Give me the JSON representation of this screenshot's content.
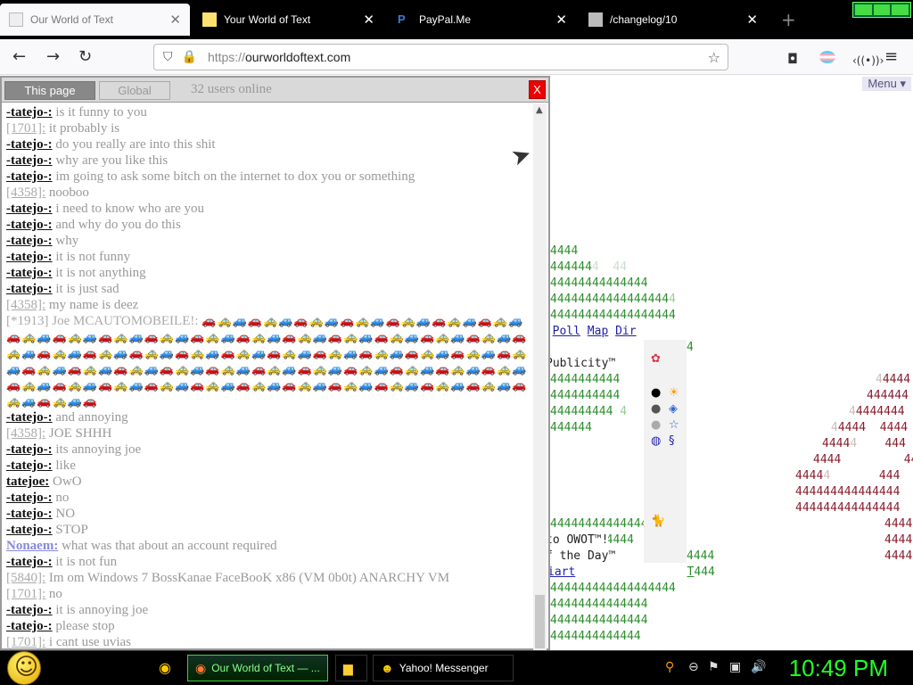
{
  "browser": {
    "tabs": [
      {
        "title": "Our World of Text",
        "active": true
      },
      {
        "title": "Your World of Text",
        "active": false
      },
      {
        "title": "PayPal.Me",
        "active": false
      },
      {
        "title": "/changelog/10",
        "active": false
      }
    ],
    "url_proto": "https://",
    "url_host": "ourworldoftext.com"
  },
  "owot": {
    "menu_label": "Menu ▾",
    "links": {
      "poll": "Poll",
      "map": "Map",
      "dir": "Dir",
      "wiki": "iart"
    },
    "texts": {
      "publicity": "Publicity™",
      "welcome": "to OWOT™!",
      "day": "f the Day™",
      "trail": "T"
    }
  },
  "chat": {
    "tab_page": "This page",
    "tab_global": "Global",
    "users_online": "32 users online",
    "close_label": "X",
    "messages": [
      {
        "nick": "-tatejo-:",
        "text": "is it funny to you"
      },
      {
        "nick": "[1701]:",
        "text": "it probably is"
      },
      {
        "nick": "-tatejo-:",
        "text": "do you really are into this shit"
      },
      {
        "nick": "-tatejo-:",
        "text": "why are you like this"
      },
      {
        "nick": "-tatejo-:",
        "text": "im going to ask some bitch on the internet to dox you or something"
      },
      {
        "nick": "[4358]:",
        "text": "nooboo"
      },
      {
        "nick": "-tatejo-:",
        "text": "i need to know who are you"
      },
      {
        "nick": "-tatejo-:",
        "text": "and why do you do this"
      },
      {
        "nick": "-tatejo-:",
        "text": "why"
      },
      {
        "nick": "-tatejo-:",
        "text": "it is not funny"
      },
      {
        "nick": "-tatejo-:",
        "text": "it is not anything"
      },
      {
        "nick": "-tatejo-:",
        "text": "it is just sad"
      },
      {
        "nick": "[4358]:",
        "text": "my name is deez"
      },
      {
        "nick": "[*1913] Joe MCAUTOMOBEILE!:",
        "text": "🚗🚕🚙🚗🚕🚙🚗🚕🚙🚗🚕🚙🚗🚕🚙🚗🚕🚙🚗🚕🚙🚗🚕🚙🚗🚕🚙🚗🚕🚙🚗🚕🚙🚗🚕🚙🚗🚕🚙🚗🚕🚙🚗🚕🚙🚗🚕🚙🚗🚕🚙🚗🚕🚙🚗🚕🚙🚗🚕🚙🚗🚕🚙🚗🚕🚙🚗🚕🚙🚗🚕🚙🚗🚕🚙🚗🚕🚙🚗🚕🚙🚗🚕🚙🚗🚕🚙🚗🚕🚙🚗🚕🚙🚗🚕🚙🚗🚕🚙🚗🚕🚙🚗🚕🚙🚗🚕🚙🚗🚕🚙🚗🚕🚙🚗🚕🚙🚗🚕🚙🚗🚕🚙🚗🚕🚙🚗🚕🚙🚗🚕🚙🚗🚕🚙🚗🚕🚙🚗🚕🚙🚗🚕🚙🚗🚕🚙🚗🚕🚙🚗🚕🚙🚗🚕🚙🚗🚕🚙🚗🚕🚙🚗"
      },
      {
        "nick": "-tatejo-:",
        "text": "and annoying"
      },
      {
        "nick": "[4358]:",
        "text": "JOE SHHH"
      },
      {
        "nick": "-tatejo-:",
        "text": "its annoying joe"
      },
      {
        "nick": "-tatejo-:",
        "text": "like"
      },
      {
        "nick": "tatejoe:",
        "text": "OwO"
      },
      {
        "nick": "-tatejo-:",
        "text": "no"
      },
      {
        "nick": "-tatejo-:",
        "text": "NO"
      },
      {
        "nick": "-tatejo-:",
        "text": "STOP"
      },
      {
        "nick": "Nonaem:",
        "text": "what was that about an account required"
      },
      {
        "nick": "-tatejo-:",
        "text": "it is not fun"
      },
      {
        "nick": "[5840]:",
        "text": "Im om Windows 7 BossKanae FaceBooK x86 (VM 0b0t) ANARCHY VM"
      },
      {
        "nick": "[1701]:",
        "text": "no"
      },
      {
        "nick": "-tatejo-:",
        "text": "it is annoying joe"
      },
      {
        "nick": "-tatejo-:",
        "text": "please stop"
      },
      {
        "nick": "[1701]:",
        "text": "i cant use uvias"
      }
    ]
  },
  "taskbar": {
    "firefox_label": "Our World of Text — ...",
    "yahoo_label": "Yahoo! Messenger",
    "clock": "10:49 PM"
  },
  "colors": {
    "grid_green": "#2c8f2c",
    "grid_red": "#8a1c2c",
    "clock_green": "#22ff22",
    "close_red": "#ee0000"
  }
}
